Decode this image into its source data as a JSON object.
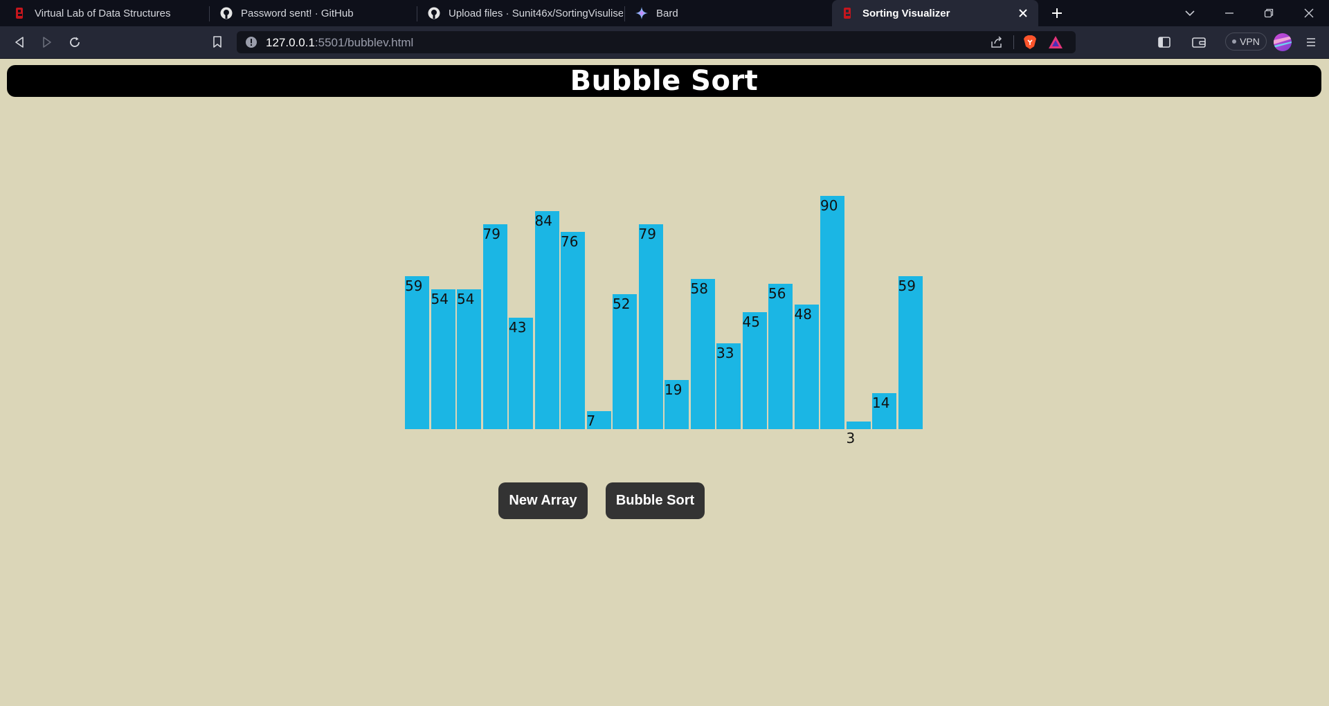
{
  "browser": {
    "tabs": [
      {
        "title": "Virtual Lab of Data Structures",
        "icon": "lab-logo-icon",
        "active": false
      },
      {
        "title": "Password sent! · GitHub",
        "icon": "github-icon",
        "active": false
      },
      {
        "title": "Upload files · Sunit46x/SortingVisuliser",
        "icon": "github-icon",
        "active": false
      },
      {
        "title": "Bard",
        "icon": "bard-sparkle-icon",
        "active": false
      },
      {
        "title": "Sorting Visualizer",
        "icon": "lab-logo-icon",
        "active": true
      }
    ],
    "address": {
      "host": "127.0.0.1",
      "rest": ":5501/bubblev.html"
    },
    "vpn_label": "VPN"
  },
  "page": {
    "title": "Bubble Sort",
    "buttons": {
      "new_array": "New Array",
      "bubble_sort": "Bubble Sort"
    }
  },
  "chart_data": {
    "type": "bar",
    "values": [
      59,
      54,
      54,
      79,
      43,
      84,
      76,
      7,
      52,
      79,
      19,
      58,
      33,
      45,
      56,
      48,
      90,
      3,
      14,
      59
    ],
    "bar_color": "#1bb6e4"
  },
  "colors": {
    "page_background": "#dbd6b8",
    "header_background": "#000000",
    "button_background": "#333333"
  }
}
